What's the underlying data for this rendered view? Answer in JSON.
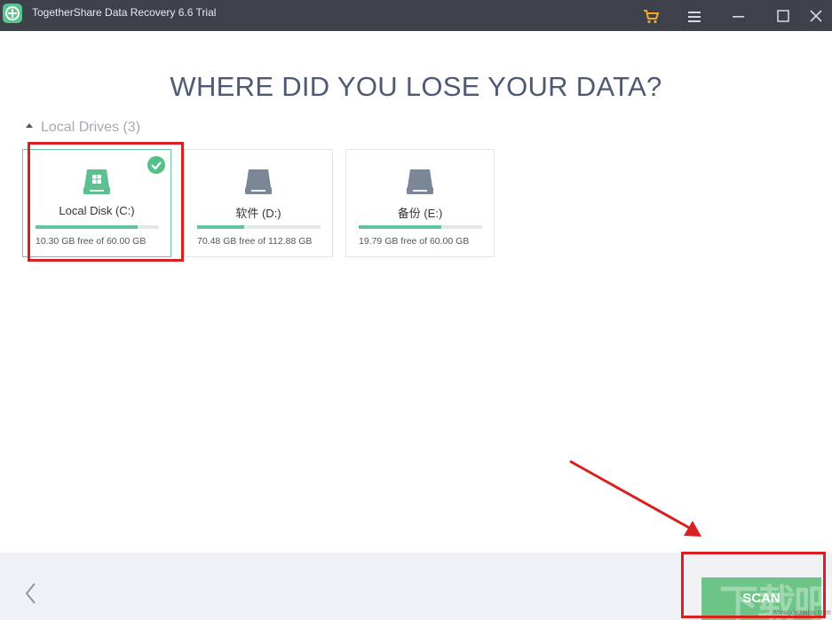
{
  "window": {
    "title": "TogetherShare Data Recovery 6.6 Trial",
    "icons": [
      "app-logo-icon",
      "cart-icon",
      "menu-icon",
      "minimize-icon",
      "maximize-icon",
      "close-icon"
    ]
  },
  "main": {
    "heading": "WHERE DID YOU LOSE YOUR DATA?",
    "section": {
      "title": "Local Drives (3)",
      "drives": [
        {
          "label": "Local Disk (C:)",
          "free_text": "10.30 GB free of 60.00 GB",
          "used_fraction": 0.83,
          "selected": true,
          "icon": "windows-drive-icon"
        },
        {
          "label": "软件 (D:)",
          "free_text": "70.48 GB free of 112.88 GB",
          "used_fraction": 0.38,
          "selected": false,
          "icon": "drive-icon"
        },
        {
          "label": "备份 (E:)",
          "free_text": "19.79 GB free of 60.00 GB",
          "used_fraction": 0.67,
          "selected": false,
          "icon": "drive-icon"
        }
      ]
    }
  },
  "footer": {
    "back_icon": "chevron-left-icon",
    "scan_label": "SCAN"
  },
  "watermark": {
    "text": "下载吧",
    "sub": "www.xiazaiba.com"
  },
  "colors": {
    "titlebar": "#3d4149",
    "accent_green": "#6cc486",
    "heading": "#4e5a73",
    "annotation_red": "#d9201f"
  }
}
